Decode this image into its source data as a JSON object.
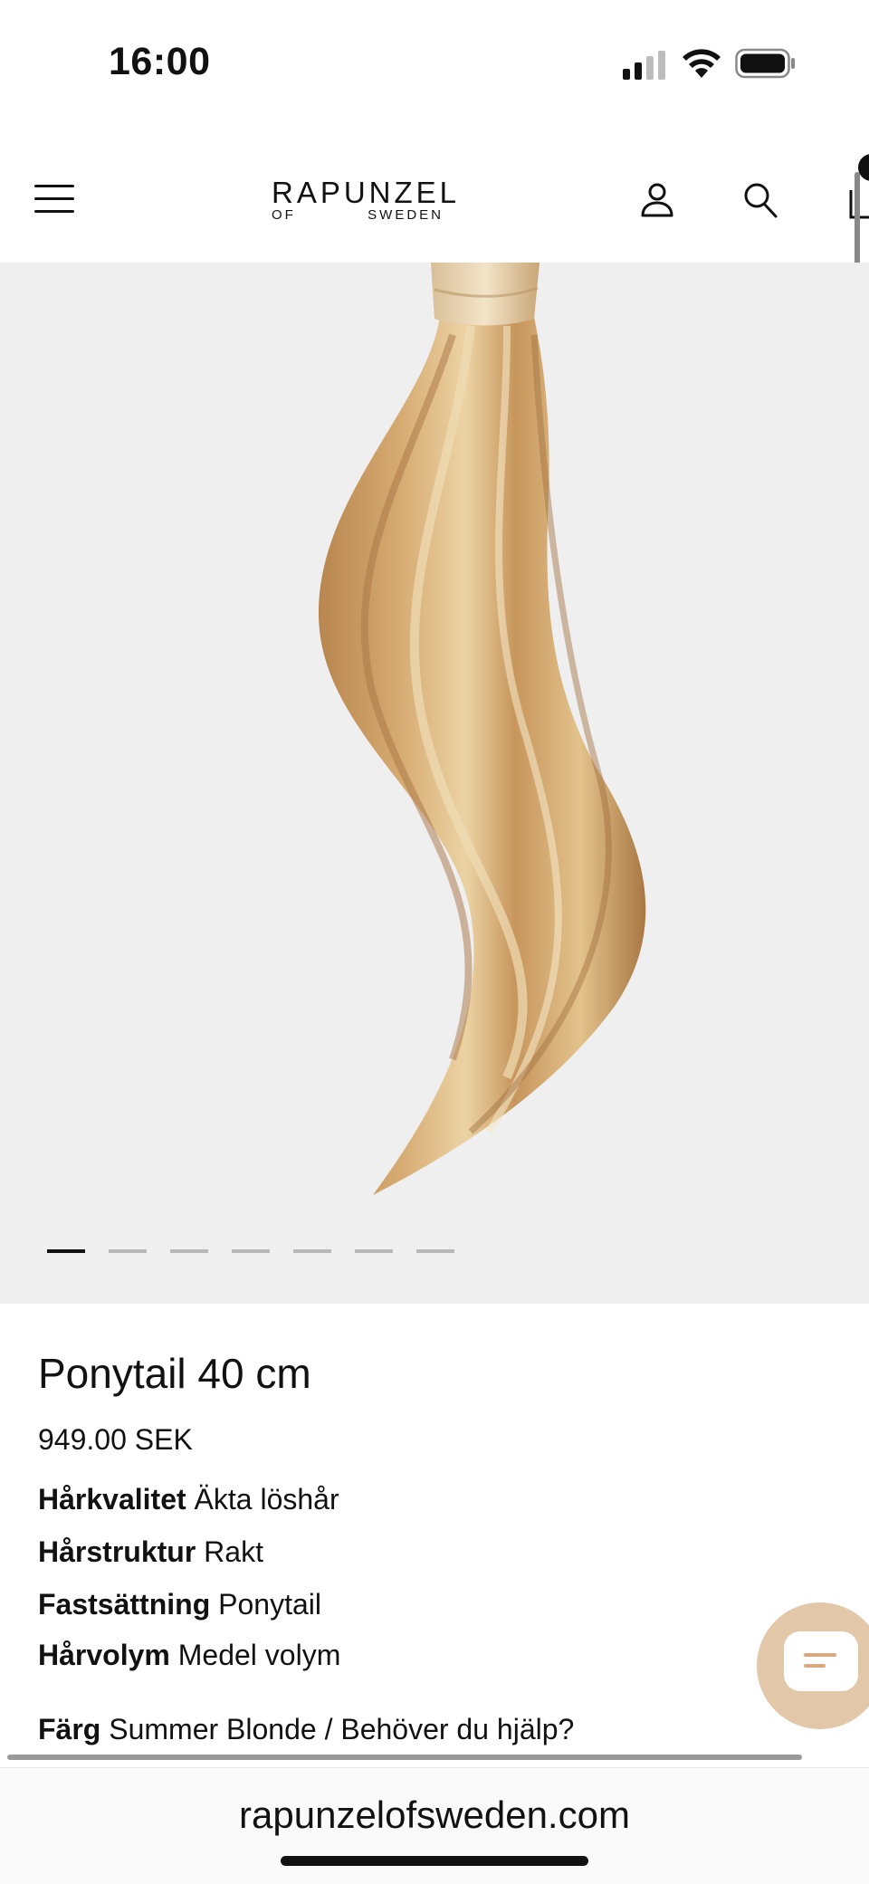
{
  "status_bar": {
    "time": "16:00"
  },
  "header": {
    "logo_top": "RAPUNZEL",
    "logo_of": "OF",
    "logo_sweden": "SWEDEN",
    "icons": [
      "menu-icon",
      "account-icon",
      "search-icon",
      "cart-icon"
    ]
  },
  "gallery": {
    "image_count": 7,
    "active_index": 0,
    "background": "#efefef"
  },
  "product": {
    "title": "Ponytail 40 cm",
    "price": "949.00 SEK",
    "attributes": [
      {
        "label": "Hårkvalitet",
        "value": "Äkta löshår"
      },
      {
        "label": "Hårstruktur",
        "value": "Rakt"
      },
      {
        "label": "Fastsättning",
        "value": "Ponytail"
      },
      {
        "label": "Hårvolym",
        "value": "Medel volym"
      },
      {
        "label": "Färg",
        "value": "Summer Blonde / Behöver du hjälp?"
      }
    ]
  },
  "chat": {
    "icon": "chat-icon",
    "color": "#e2c7a8"
  },
  "browser": {
    "url": "rapunzelofsweden.com"
  }
}
